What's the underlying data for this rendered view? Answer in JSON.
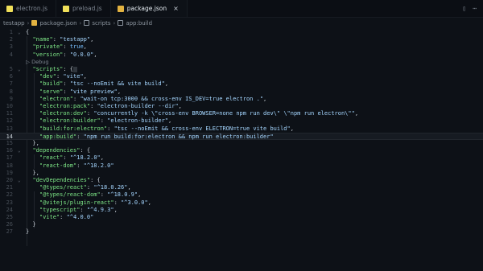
{
  "tabs": [
    {
      "label": "electron.js",
      "icon": "js-file-icon",
      "color": "#f1e05a",
      "active": false
    },
    {
      "label": "preload.js",
      "icon": "js-file-icon",
      "color": "#f1e05a",
      "active": false
    },
    {
      "label": "package.json",
      "icon": "json-file-icon",
      "color": "#e3b341",
      "active": true
    }
  ],
  "tab_close": "×",
  "breadcrumb": {
    "root": "testapp",
    "file": "package.json",
    "obj": "scripts",
    "prop": "app:build",
    "sep": "›"
  },
  "codelens": "▷ Debug",
  "current_line": 14,
  "lines": [
    {
      "n": "1",
      "text": "{"
    },
    {
      "n": "2",
      "text": "  \"name\": \"testapp\","
    },
    {
      "n": "3",
      "text": "  \"private\": true,"
    },
    {
      "n": "4",
      "text": "  \"version\": \"0.0.0\","
    },
    {
      "n": "5",
      "text": "  \"scripts\": {"
    },
    {
      "n": "6",
      "text": "    \"dev\": \"vite\","
    },
    {
      "n": "7",
      "text": "    \"build\": \"tsc --noEmit && vite build\","
    },
    {
      "n": "8",
      "text": "    \"serve\": \"vite preview\","
    },
    {
      "n": "9",
      "text": "    \"electron\": \"wait-on tcp:3000 && cross-env IS_DEV=true electron .\","
    },
    {
      "n": "10",
      "text": "    \"electron:pack\": \"electron-builder --dir\","
    },
    {
      "n": "11",
      "text": "    \"electron:dev\": \"concurrently -k \\\"cross-env BROWSER=none npm run dev\\\" \\\"npm run electron\\\"\","
    },
    {
      "n": "12",
      "text": "    \"electron:builder\": \"electron-builder\","
    },
    {
      "n": "13",
      "text": "    \"build:for:electron\": \"tsc --noEmit && cross-env ELECTRON=true vite build\","
    },
    {
      "n": "14",
      "text": "    \"app:build\": \"npm run build:for:electron && npm run electron:builder\""
    },
    {
      "n": "15",
      "text": "  },"
    },
    {
      "n": "16",
      "text": "  \"dependencies\": {"
    },
    {
      "n": "17",
      "text": "    \"react\": \"^18.2.0\","
    },
    {
      "n": "18",
      "text": "    \"react-dom\": \"^18.2.0\""
    },
    {
      "n": "19",
      "text": "  },"
    },
    {
      "n": "20",
      "text": "  \"devDependencies\": {"
    },
    {
      "n": "21",
      "text": "    \"@types/react\": \"^18.0.26\","
    },
    {
      "n": "22",
      "text": "    \"@types/react-dom\": \"^18.0.9\","
    },
    {
      "n": "23",
      "text": "    \"@vitejs/plugin-react\": \"^3.0.0\","
    },
    {
      "n": "24",
      "text": "    \"typescript\": \"^4.9.3\","
    },
    {
      "n": "25",
      "text": "    \"vite\": \"^4.0.0\""
    },
    {
      "n": "26",
      "text": "  }"
    },
    {
      "n": "27",
      "text": "}"
    }
  ]
}
